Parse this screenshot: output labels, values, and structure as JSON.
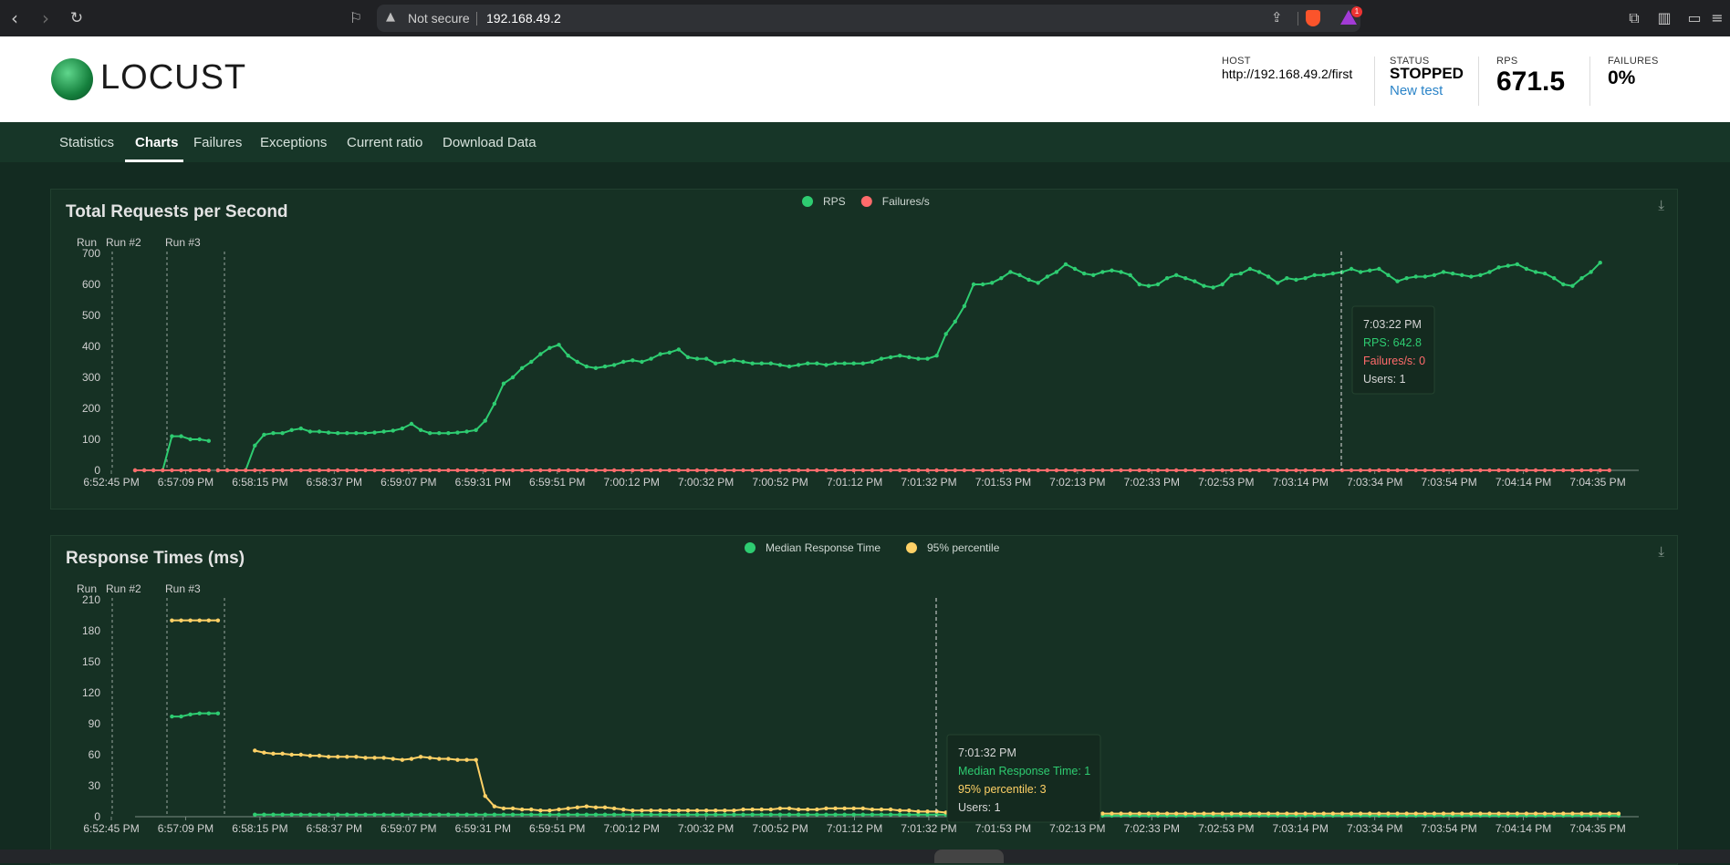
{
  "browser": {
    "security_label": "Not secure",
    "url": "192.168.49.2",
    "rewards_count": "1",
    "icons": [
      "back-icon",
      "forward-icon",
      "reload-icon",
      "bookmark-icon",
      "warning-icon",
      "share-icon",
      "brave-shield-icon",
      "brave-rewards-icon",
      "extensions-icon",
      "sidebar-icon",
      "wallet-icon",
      "menu-icon"
    ]
  },
  "header": {
    "logo_text": "LOCUST",
    "host_label": "HOST",
    "host_value": "http://192.168.49.2/first",
    "status_label": "STATUS",
    "status_value": "STOPPED",
    "new_test_label": "New test",
    "rps_label": "RPS",
    "rps_value": "671.5",
    "failures_label": "FAILURES",
    "failures_value": "0%"
  },
  "tabs": [
    {
      "label": "Statistics",
      "active": false
    },
    {
      "label": "Charts",
      "active": true
    },
    {
      "label": "Failures",
      "active": false
    },
    {
      "label": "Exceptions",
      "active": false
    },
    {
      "label": "Current ratio",
      "active": false
    },
    {
      "label": "Download Data",
      "active": false
    }
  ],
  "colors": {
    "green": "#2ecc71",
    "red": "#ff6b6b",
    "yellow": "#ffd166",
    "card_bg": "#163124"
  },
  "chart_data": [
    {
      "type": "line",
      "title": "Total Requests per Second",
      "legend": [
        "RPS",
        "Failures/s"
      ],
      "legend_position": "top",
      "markers": [
        "Run",
        "Run #2",
        "Run #3"
      ],
      "x_ticks": [
        "6:52:45 PM",
        "6:57:09 PM",
        "6:58:15 PM",
        "6:58:37 PM",
        "6:59:07 PM",
        "6:59:31 PM",
        "6:59:51 PM",
        "7:00:12 PM",
        "7:00:32 PM",
        "7:00:52 PM",
        "7:01:12 PM",
        "7:01:32 PM",
        "7:01:53 PM",
        "7:02:13 PM",
        "7:02:33 PM",
        "7:02:53 PM",
        "7:03:14 PM",
        "7:03:34 PM",
        "7:03:54 PM",
        "7:04:14 PM",
        "7:04:35 PM"
      ],
      "y_ticks": [
        0,
        100,
        200,
        300,
        400,
        500,
        600,
        700
      ],
      "ylim": [
        0,
        700
      ],
      "series": [
        {
          "name": "RPS",
          "values": [
            0,
            0,
            0,
            0,
            110,
            110,
            100,
            100,
            95,
            0,
            0,
            0,
            0,
            80,
            115,
            120,
            120,
            130,
            135,
            125,
            125,
            122,
            120,
            120,
            120,
            120,
            122,
            125,
            128,
            135,
            150,
            130,
            120,
            120,
            120,
            122,
            125,
            130,
            160,
            215,
            280,
            300,
            330,
            350,
            375,
            395,
            405,
            370,
            350,
            335,
            330,
            335,
            340,
            350,
            355,
            350,
            360,
            375,
            380,
            390,
            365,
            360,
            360,
            345,
            350,
            355,
            350,
            345,
            345,
            345,
            340,
            335,
            340,
            345,
            345,
            340,
            345,
            345,
            345,
            345,
            350,
            360,
            365,
            370,
            365,
            360,
            360,
            370,
            440,
            480,
            530,
            600,
            600,
            605,
            620,
            640,
            630,
            615,
            605,
            625,
            640,
            665,
            650,
            635,
            630,
            640,
            645,
            640,
            630,
            600,
            595,
            600,
            620,
            630,
            620,
            610,
            595,
            590,
            600,
            630,
            635,
            650,
            640,
            625,
            605,
            620,
            615,
            620,
            630,
            630,
            635,
            640,
            650,
            640,
            645,
            650,
            630,
            610,
            620,
            625,
            625,
            630,
            640,
            635,
            630,
            625,
            630,
            640,
            655,
            660,
            665,
            650,
            640,
            635,
            620,
            600,
            595,
            620,
            640,
            670
          ]
        },
        {
          "name": "Failures/s",
          "values": [
            0,
            0,
            0,
            0,
            0,
            0,
            0,
            0,
            0,
            0,
            0,
            0,
            0,
            0,
            0,
            0,
            0,
            0,
            0,
            0,
            0,
            0,
            0,
            0,
            0,
            0,
            0,
            0,
            0,
            0,
            0,
            0,
            0,
            0,
            0,
            0,
            0,
            0,
            0,
            0,
            0,
            0,
            0,
            0,
            0,
            0,
            0,
            0,
            0,
            0,
            0,
            0,
            0,
            0,
            0,
            0,
            0,
            0,
            0,
            0,
            0,
            0,
            0,
            0,
            0,
            0,
            0,
            0,
            0,
            0,
            0,
            0,
            0,
            0,
            0,
            0,
            0,
            0,
            0,
            0,
            0,
            0,
            0,
            0,
            0,
            0,
            0,
            0,
            0,
            0,
            0,
            0,
            0,
            0,
            0,
            0,
            0,
            0,
            0,
            0,
            0,
            0,
            0,
            0,
            0,
            0,
            0,
            0,
            0,
            0,
            0,
            0,
            0,
            0,
            0,
            0,
            0,
            0,
            0,
            0,
            0,
            0,
            0,
            0,
            0,
            0,
            0,
            0,
            0,
            0,
            0,
            0,
            0,
            0,
            0,
            0,
            0,
            0,
            0,
            0,
            0,
            0,
            0,
            0,
            0,
            0,
            0,
            0,
            0,
            0,
            0,
            0,
            0,
            0,
            0,
            0,
            0,
            0,
            0,
            0,
            0
          ]
        }
      ],
      "tooltip": {
        "time": "7:03:22 PM",
        "rps": "RPS: 642.8",
        "failures": "Failures/s: 0",
        "users": "Users: 1"
      }
    },
    {
      "type": "line",
      "title": "Response Times (ms)",
      "legend": [
        "Median Response Time",
        "95% percentile"
      ],
      "legend_position": "top",
      "markers": [
        "Run",
        "Run #2",
        "Run #3"
      ],
      "x_ticks": [
        "6:52:45 PM",
        "6:57:09 PM",
        "6:58:15 PM",
        "6:58:37 PM",
        "6:59:07 PM",
        "6:59:31 PM",
        "6:59:51 PM",
        "7:00:12 PM",
        "7:00:32 PM",
        "7:00:52 PM",
        "7:01:12 PM",
        "7:01:32 PM",
        "7:01:53 PM",
        "7:02:13 PM",
        "7:02:33 PM",
        "7:02:53 PM",
        "7:03:14 PM",
        "7:03:34 PM",
        "7:03:54 PM",
        "7:04:14 PM",
        "7:04:35 PM"
      ],
      "y_ticks": [
        0,
        30,
        60,
        90,
        120,
        150,
        180,
        210
      ],
      "ylim": [
        0,
        210
      ],
      "series": [
        {
          "name": "Median Response Time",
          "segments": [
            {
              "start_index": 4,
              "values": [
                97,
                97,
                99,
                100,
                100,
                100
              ]
            },
            {
              "start_index": 13,
              "values": [
                2,
                2,
                2,
                2,
                2,
                2,
                2,
                2,
                2,
                2,
                2,
                2,
                2,
                2,
                2,
                2,
                2,
                2,
                2,
                2,
                2,
                2,
                2,
                2,
                2,
                2,
                2,
                2,
                2,
                2,
                2,
                2,
                2,
                2,
                2,
                2,
                2,
                2,
                2,
                2,
                2,
                2,
                2,
                2,
                2,
                2,
                2,
                2,
                2,
                2,
                2,
                2,
                2,
                2,
                2,
                2,
                2,
                2,
                2,
                2,
                2,
                2,
                2,
                2,
                2,
                2,
                2,
                2,
                2,
                2,
                2,
                2,
                2,
                2,
                2,
                2,
                2,
                1,
                1,
                1,
                1,
                1,
                1,
                1,
                1,
                1,
                1,
                1,
                1,
                1,
                1,
                1,
                1,
                1,
                1,
                1,
                1,
                1,
                1,
                1,
                1,
                1,
                1,
                1,
                1,
                1,
                1,
                1,
                1,
                1,
                1,
                1,
                1,
                1,
                1,
                1,
                1,
                1,
                1,
                1,
                1,
                1,
                1,
                1,
                1,
                1,
                1,
                1,
                1,
                1,
                1,
                1,
                1,
                1,
                1,
                1,
                1,
                1,
                1,
                1,
                1,
                1,
                1,
                1,
                1,
                1,
                1,
                1,
                1
              ]
            }
          ]
        },
        {
          "name": "95% percentile",
          "segments": [
            {
              "start_index": 4,
              "values": [
                190,
                190,
                190,
                190,
                190,
                190
              ]
            },
            {
              "start_index": 13,
              "values": [
                64,
                62,
                61,
                61,
                60,
                60,
                59,
                59,
                58,
                58,
                58,
                58,
                57,
                57,
                57,
                56,
                55,
                56,
                58,
                57,
                56,
                56,
                55,
                55,
                55,
                20,
                10,
                8,
                8,
                7,
                7,
                6,
                6,
                7,
                8,
                9,
                10,
                9,
                9,
                8,
                7,
                6,
                6,
                6,
                6,
                6,
                6,
                6,
                6,
                6,
                6,
                6,
                6,
                7,
                7,
                7,
                7,
                8,
                8,
                7,
                7,
                7,
                8,
                8,
                8,
                8,
                8,
                7,
                7,
                7,
                6,
                6,
                5,
                5,
                5,
                4,
                4,
                3,
                3,
                3,
                3,
                3,
                3,
                3,
                3,
                3,
                3,
                3,
                3,
                3,
                3,
                3,
                3,
                3,
                3,
                3,
                3,
                3,
                3,
                3,
                3,
                3,
                3,
                3,
                3,
                3,
                3,
                3,
                3,
                3,
                3,
                3,
                3,
                3,
                3,
                3,
                3,
                3,
                3,
                3,
                3,
                3,
                3,
                3,
                3,
                3,
                3,
                3,
                3,
                3,
                3,
                3,
                3,
                3,
                3,
                3,
                3,
                3,
                3,
                3,
                3,
                3,
                3,
                3,
                3,
                3,
                3,
                3,
                3
              ]
            }
          ]
        }
      ],
      "tooltip": {
        "time": "7:01:32 PM",
        "median": "Median Response Time: 1",
        "p95": "95% percentile: 3",
        "users": "Users: 1"
      }
    }
  ]
}
